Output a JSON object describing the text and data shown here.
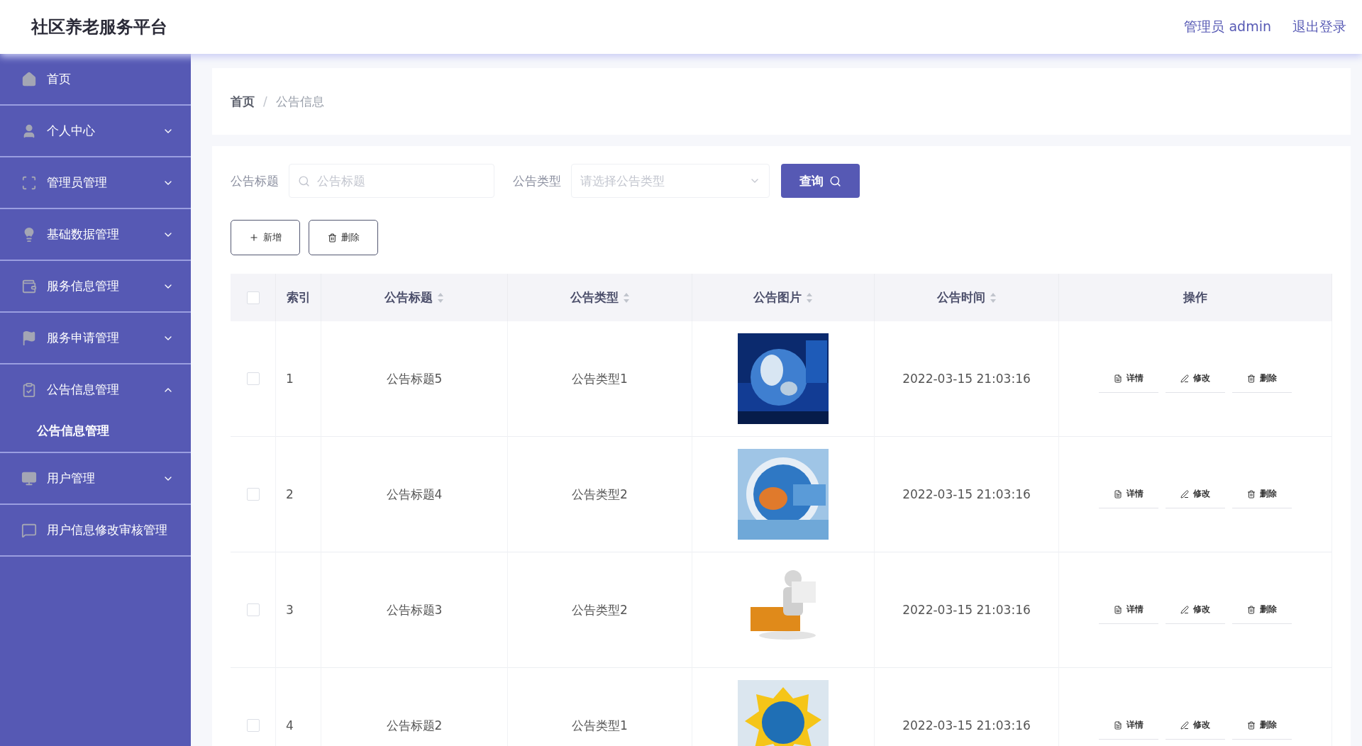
{
  "header": {
    "title": "社区养老服务平台",
    "user": "管理员 admin",
    "logout": "退出登录"
  },
  "sidebar": {
    "items": [
      {
        "label": "首页"
      },
      {
        "label": "个人中心",
        "expanded": false
      },
      {
        "label": "管理员管理",
        "expanded": false
      },
      {
        "label": "基础数据管理",
        "expanded": false
      },
      {
        "label": "服务信息管理",
        "expanded": false
      },
      {
        "label": "服务申请管理",
        "expanded": false
      },
      {
        "label": "公告信息管理",
        "expanded": true,
        "children": [
          {
            "label": "公告信息管理"
          }
        ]
      },
      {
        "label": "用户管理",
        "expanded": false
      },
      {
        "label": "用户信息修改审核管理"
      }
    ]
  },
  "breadcrumb": {
    "items": [
      "首页",
      "公告信息"
    ],
    "separator": "/"
  },
  "search": {
    "title_label": "公告标题",
    "title_placeholder": "公告标题",
    "type_label": "公告类型",
    "type_placeholder": "请选择公告类型",
    "query_button": "查询"
  },
  "toolbar": {
    "add": "新增",
    "delete": "删除"
  },
  "table": {
    "all_checked": false,
    "columns": [
      {
        "label": "索引",
        "sortable": false
      },
      {
        "label": "公告标题",
        "sortable": true
      },
      {
        "label": "公告类型",
        "sortable": true
      },
      {
        "label": "公告图片",
        "sortable": true
      },
      {
        "label": "公告时间",
        "sortable": true
      },
      {
        "label": "操作",
        "sortable": false
      }
    ],
    "rows": [
      {
        "checked": false,
        "index": "1",
        "title": "公告标题5",
        "type": "公告类型1",
        "image": {
          "kind": "picture"
        },
        "time": "2022-03-15 21:03:16",
        "actions": [
          "详情",
          "修改",
          "删除"
        ]
      },
      {
        "checked": false,
        "index": "2",
        "title": "公告标题4",
        "type": "公告类型2",
        "image": {
          "kind": "picture"
        },
        "time": "2022-03-15 21:03:16",
        "actions": [
          "详情",
          "修改",
          "删除"
        ]
      },
      {
        "checked": false,
        "index": "3",
        "title": "公告标题3",
        "type": "公告类型2",
        "image": {
          "kind": "picture"
        },
        "time": "2022-03-15 21:03:16",
        "actions": [
          "详情",
          "修改",
          "删除"
        ]
      },
      {
        "checked": false,
        "index": "4",
        "title": "公告标题2",
        "type": "公告类型1",
        "image": {
          "kind": "picture"
        },
        "time": "2022-03-15 21:03:16",
        "actions": [
          "详情",
          "修改",
          "删除"
        ]
      }
    ]
  }
}
